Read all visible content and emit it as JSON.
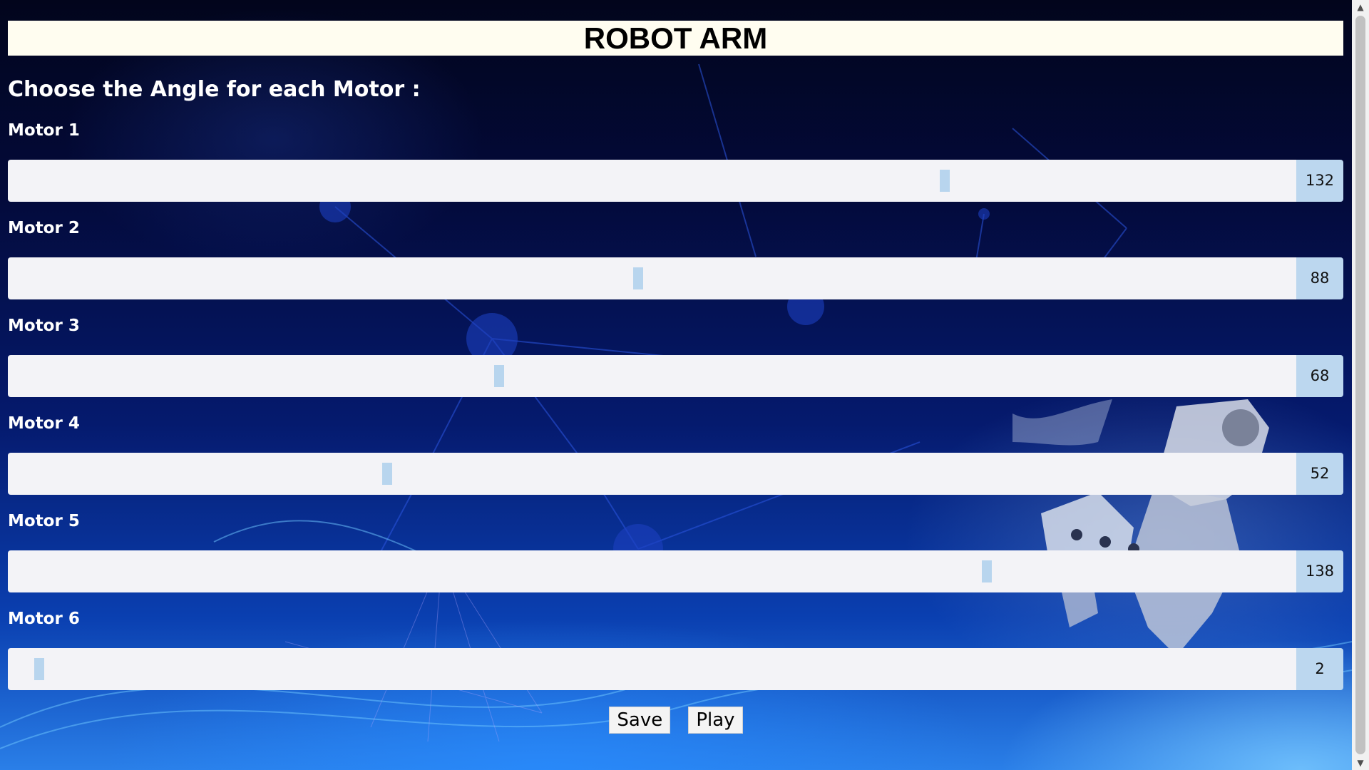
{
  "header": {
    "title": "ROBOT ARM"
  },
  "subtitle": "Choose the Angle for each Motor :",
  "slider": {
    "min": 0,
    "max": 180
  },
  "motors": [
    {
      "label": "Motor 1",
      "value": 132
    },
    {
      "label": "Motor 2",
      "value": 88
    },
    {
      "label": "Motor 3",
      "value": 68
    },
    {
      "label": "Motor 4",
      "value": 52
    },
    {
      "label": "Motor 5",
      "value": 138
    },
    {
      "label": "Motor 6",
      "value": 2
    }
  ],
  "buttons": {
    "save": "Save",
    "play": "Play"
  },
  "scrollbar": {
    "up_icon": "chevron-up-icon",
    "down_icon": "chevron-down-icon"
  },
  "colors": {
    "title_bg": "#fffdf0",
    "track_bg": "#f3f3f7",
    "thumb": "#b8d5ee",
    "value_bg": "#bcd7ef",
    "page_bg_top": "#02051c",
    "page_bg_bottom": "#2a7fe8"
  }
}
